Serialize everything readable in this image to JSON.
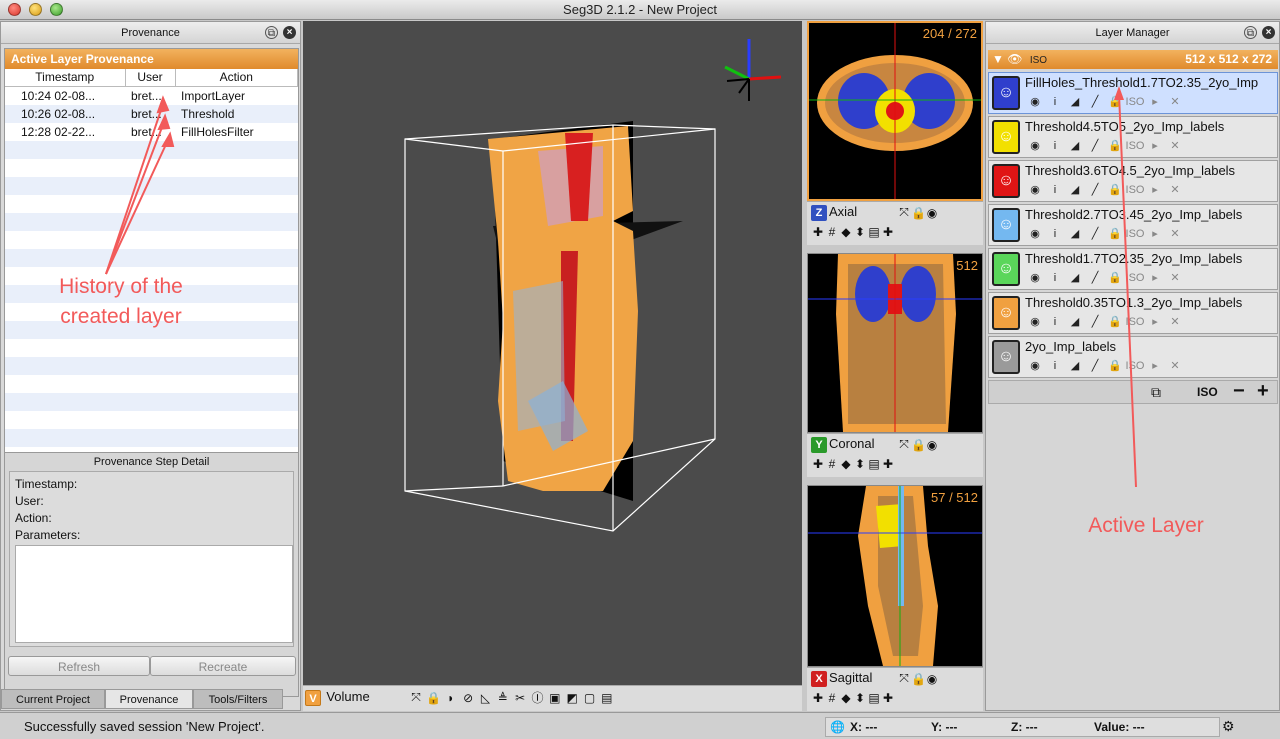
{
  "window": {
    "title": "Seg3D 2.1.2  - New Project"
  },
  "provenance": {
    "panel_title": "Provenance",
    "active_header": "Active Layer Provenance",
    "columns": [
      "Timestamp",
      "User",
      "Action"
    ],
    "rows": [
      {
        "timestamp": "10:24 02-08...",
        "user": "bret...",
        "action": "ImportLayer"
      },
      {
        "timestamp": "10:26 02-08...",
        "user": "bret...",
        "action": "Threshold"
      },
      {
        "timestamp": "12:28 02-22...",
        "user": "bret...",
        "action": "FillHolesFilter"
      }
    ],
    "step_detail_title": "Provenance Step Detail",
    "labels": {
      "timestamp": "Timestamp:",
      "user": "User:",
      "action": "Action:",
      "parameters": "Parameters:"
    },
    "buttons": {
      "refresh": "Refresh",
      "recreate": "Recreate"
    },
    "tabs": [
      "Current Project",
      "Provenance",
      "Tools/Filters"
    ]
  },
  "annotations": {
    "history": "History of the created layer",
    "active": "Active Layer"
  },
  "viewers": {
    "volume": {
      "letter": "V",
      "label": "Volume"
    },
    "axial": {
      "letter": "Z",
      "label": "Axial",
      "slice": "204 / 272"
    },
    "coronal": {
      "letter": "Y",
      "label": "Coronal",
      "slice": "/ 512"
    },
    "sagittal": {
      "letter": "X",
      "label": "Sagittal",
      "slice": "57 / 512"
    }
  },
  "layer_manager": {
    "title": "Layer Manager",
    "group_label": "ISO",
    "group_size": "512 x 512 x 272",
    "layers": [
      {
        "name": "FillHoles_Threshold1.7TO2.35_2yo_Imp",
        "color": "#2f3fcc",
        "active": true
      },
      {
        "name": "Threshold4.5TO5_2yo_Imp_labels",
        "color": "#f2e000",
        "active": false
      },
      {
        "name": "Threshold3.6TO4.5_2yo_Imp_labels",
        "color": "#e01515",
        "active": false
      },
      {
        "name": "Threshold2.7TO3.45_2yo_Imp_labels",
        "color": "#74b8f0",
        "active": false
      },
      {
        "name": "Threshold1.7TO2.35_2yo_Imp_labels",
        "color": "#5ad65a",
        "active": false
      },
      {
        "name": "Threshold0.35TO1.3_2yo_Imp_labels",
        "color": "#f0a040",
        "active": false
      },
      {
        "name": "2yo_Imp_labels",
        "color": "#9a9a9a",
        "active": false
      }
    ],
    "footer_iso": "ISO"
  },
  "status": {
    "message": "Successfully saved session 'New Project'.",
    "x": "X: ---",
    "y": "Y: ---",
    "z": "Z: ---",
    "value": "Value: ---"
  }
}
